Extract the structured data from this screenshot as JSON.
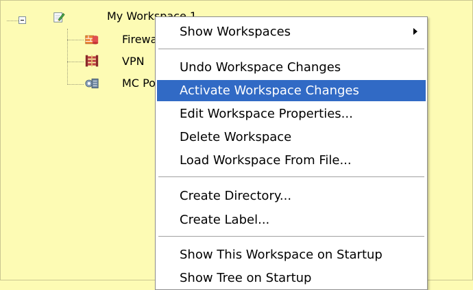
{
  "tree": {
    "root": {
      "label": "My Workspace 1",
      "icon": "workspace-edit-icon",
      "expanded": true
    },
    "children": [
      {
        "label": "Firewall",
        "icon": "firewall-icon"
      },
      {
        "label": "VPN",
        "icon": "vpn-icon"
      },
      {
        "label": "MC Policy",
        "icon": "mc-policy-icon"
      }
    ]
  },
  "menu": {
    "items": [
      {
        "label": "Show Workspaces",
        "has_submenu": true
      },
      {
        "label": "Undo Workspace Changes"
      },
      {
        "label": "Activate Workspace Changes",
        "highlighted": true
      },
      {
        "label": "Edit Workspace Properties..."
      },
      {
        "label": "Delete Workspace"
      },
      {
        "label": "Load Workspace From File..."
      },
      {
        "label": "Create Directory..."
      },
      {
        "label": "Create Label..."
      },
      {
        "label": "Show This Workspace on Startup"
      },
      {
        "label": "Show Tree on Startup"
      }
    ]
  },
  "colors": {
    "background": "#fdfbb4",
    "highlight": "#316ac5",
    "highlight_text": "#ffffff"
  }
}
